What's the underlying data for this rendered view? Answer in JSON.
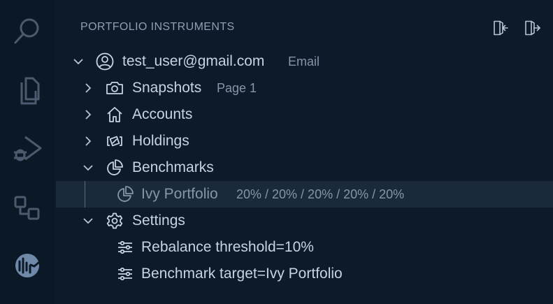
{
  "panel": {
    "title": "PORTFOLIO INSTRUMENTS",
    "actions": [
      {
        "icon": "sign-in-icon"
      },
      {
        "icon": "sign-out-icon"
      }
    ]
  },
  "activity_bar": [
    {
      "icon": "search-icon"
    },
    {
      "icon": "files-icon"
    },
    {
      "icon": "run-debug-icon"
    },
    {
      "icon": "extensions-icon"
    },
    {
      "icon": "portfolio-extension-icon"
    }
  ],
  "tree": {
    "account": {
      "label": "test_user@gmail.com",
      "description": "Email",
      "icon": "account-icon",
      "expanded": true
    },
    "snapshots": {
      "label": "Snapshots",
      "description": "Page 1",
      "icon": "camera-icon",
      "expanded": false
    },
    "accounts": {
      "label": "Accounts",
      "icon": "home-icon",
      "expanded": false
    },
    "holdings": {
      "label": "Holdings",
      "icon": "holdings-icon",
      "expanded": false
    },
    "benchmarks": {
      "label": "Benchmarks",
      "icon": "pie-chart-icon",
      "expanded": true
    },
    "benchmark_item": {
      "label": "Ivy Portfolio",
      "description": "20% / 20% / 20% / 20% / 20%",
      "icon": "pie-chart-icon",
      "selected": true
    },
    "settings": {
      "label": "Settings",
      "icon": "gear-icon",
      "expanded": true
    },
    "setting_items": [
      {
        "label": "Rebalance threshold=10%",
        "icon": "settings-sliders-icon"
      },
      {
        "label": "Benchmark target=Ivy Portfolio",
        "icon": "settings-sliders-icon"
      }
    ]
  },
  "colors": {
    "background": "#0c1a29",
    "selected_row": "#1a2a3a",
    "text": "#c7d3df",
    "muted_text": "#8596a9",
    "icon_inactive": "#4a5b6d"
  }
}
